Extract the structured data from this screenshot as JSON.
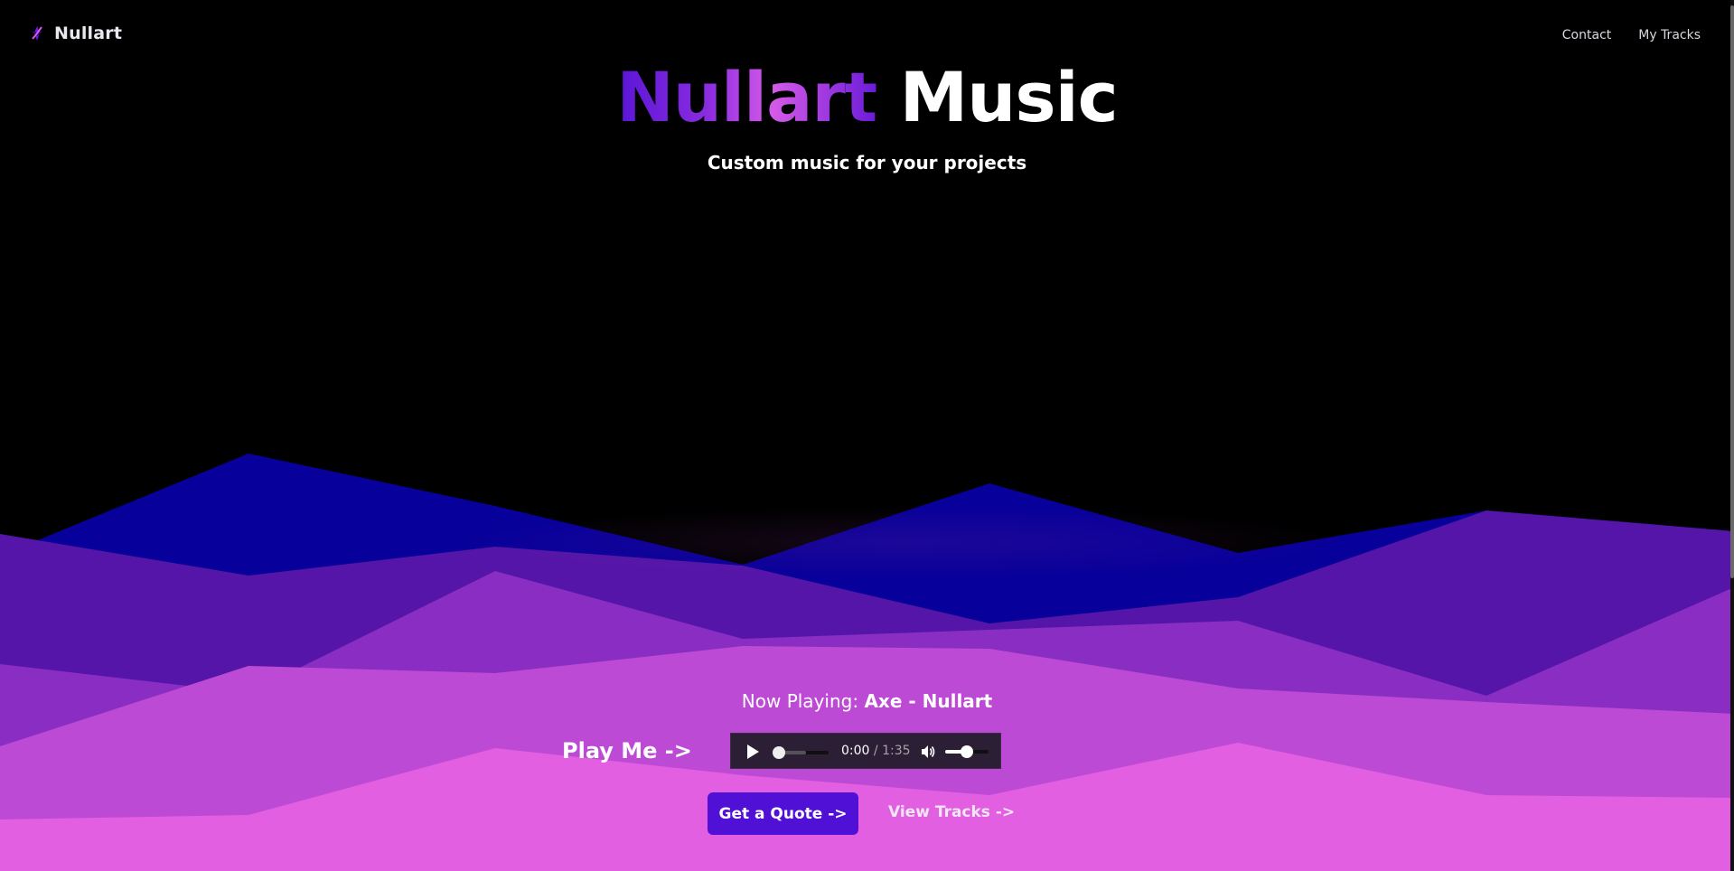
{
  "nav": {
    "brand": "Nullart",
    "links": [
      {
        "label": "Contact"
      },
      {
        "label": "My Tracks"
      }
    ]
  },
  "hero": {
    "title_brand": "Nullart",
    "title_rest": "Music",
    "subtitle": "Custom music for your projects"
  },
  "player": {
    "now_playing_label": "Now Playing:",
    "track": "Axe - Nullart",
    "play_me": "Play Me ->",
    "current_time": "0:00",
    "separator": "/",
    "duration": "1:35",
    "progress": 0.0,
    "volume": 0.5
  },
  "actions": {
    "quote_label": "Get a Quote ->",
    "view_tracks_label": "View Tracks ->"
  },
  "colors": {
    "background": "#000000",
    "accent": "#5110d6",
    "mountain_layers": [
      "#08009a",
      "#5515a8",
      "#8a2dc2",
      "#bd4ad4",
      "#e35fe2"
    ]
  },
  "icons": {
    "brand_logo": "nullart-logo-icon",
    "play": "play-icon",
    "volume": "volume-icon"
  }
}
